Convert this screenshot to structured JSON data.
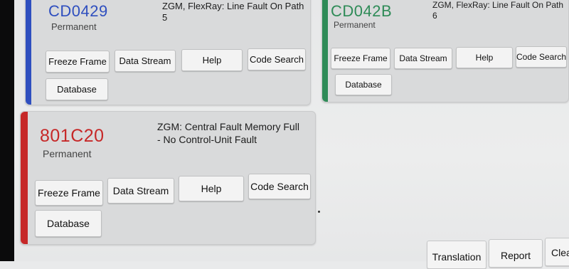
{
  "colors": {
    "blue": "#2f4fbf",
    "green": "#2e8b57",
    "red": "#c62828"
  },
  "fault_cards": [
    {
      "code": "CD0429",
      "status": "Permanent",
      "description": "ZGM, FlexRay: Line Fault On Path 5",
      "buttons": {
        "freeze_frame": "Freeze Frame",
        "data_stream": "Data Stream",
        "help": "Help",
        "code_search": "Code Search",
        "database": "Database"
      }
    },
    {
      "code": "CD042B",
      "status": "Permanent",
      "description": "ZGM, FlexRay: Line Fault On Path 6",
      "buttons": {
        "freeze_frame": "Freeze Frame",
        "data_stream": "Data Stream",
        "help": "Help",
        "code_search": "Code Search",
        "database": "Database"
      }
    },
    {
      "code": "801C20",
      "status": "Permanent",
      "description_line1": "ZGM: Central Fault Memory Full",
      "description_line2": "- No Control-Unit Fault",
      "buttons": {
        "freeze_frame": "Freeze Frame",
        "data_stream": "Data Stream",
        "help": "Help",
        "code_search": "Code Search",
        "database": "Database"
      }
    }
  ],
  "bottom_bar": {
    "translation": "Translation",
    "report": "Report",
    "clear": "Clea"
  }
}
